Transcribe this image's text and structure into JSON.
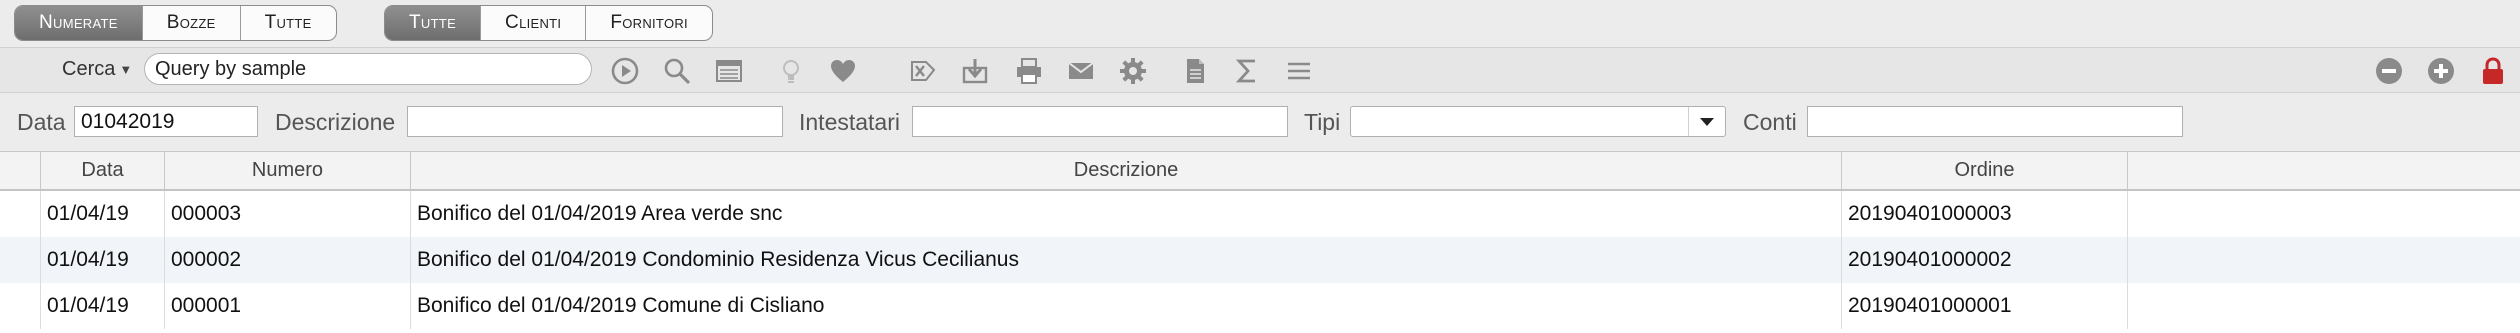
{
  "tabs": {
    "doc_state": [
      {
        "label": "Numerate",
        "active": true
      },
      {
        "label": "Bozze",
        "active": false
      },
      {
        "label": "Tutte",
        "active": false
      }
    ],
    "party_type": [
      {
        "label": "Tutte",
        "active": true
      },
      {
        "label": "Clienti",
        "active": false
      },
      {
        "label": "Fornitori",
        "active": false
      }
    ]
  },
  "toolbar": {
    "search_label": "Cerca",
    "search_value": "Query by sample",
    "icons_left": [
      "play-icon",
      "magnifier-icon",
      "list-view-icon",
      "lightbulb-icon",
      "heart-icon",
      "excel-icon",
      "download-icon",
      "print-icon",
      "mail-icon",
      "gear-icon",
      "document-icon",
      "sigma-icon",
      "menu-icon"
    ],
    "icons_right": [
      "remove-icon",
      "add-icon",
      "lock-icon"
    ],
    "accent_red": "#c62828"
  },
  "filters": {
    "data_label": "Data",
    "data_value": "01042019",
    "descrizione_label": "Descrizione",
    "descrizione_value": "",
    "intestatari_label": "Intestatari",
    "intestatari_value": "",
    "tipi_label": "Tipi",
    "tipi_value": "",
    "conti_label": "Conti",
    "conti_value": ""
  },
  "table": {
    "columns": [
      "",
      "Data",
      "Numero",
      "Descrizione",
      "Ordine",
      ""
    ],
    "rows": [
      {
        "data": "01/04/19",
        "numero": "000003",
        "descrizione": "Bonifico del 01/04/2019 Area verde snc",
        "ordine": "20190401000003"
      },
      {
        "data": "01/04/19",
        "numero": "000002",
        "descrizione": "Bonifico del 01/04/2019 Condominio Residenza Vicus Cecilianus",
        "ordine": "20190401000002"
      },
      {
        "data": "01/04/19",
        "numero": "000001",
        "descrizione": "Bonifico del 01/04/2019 Comune di Cisliano",
        "ordine": "20190401000001"
      }
    ]
  }
}
